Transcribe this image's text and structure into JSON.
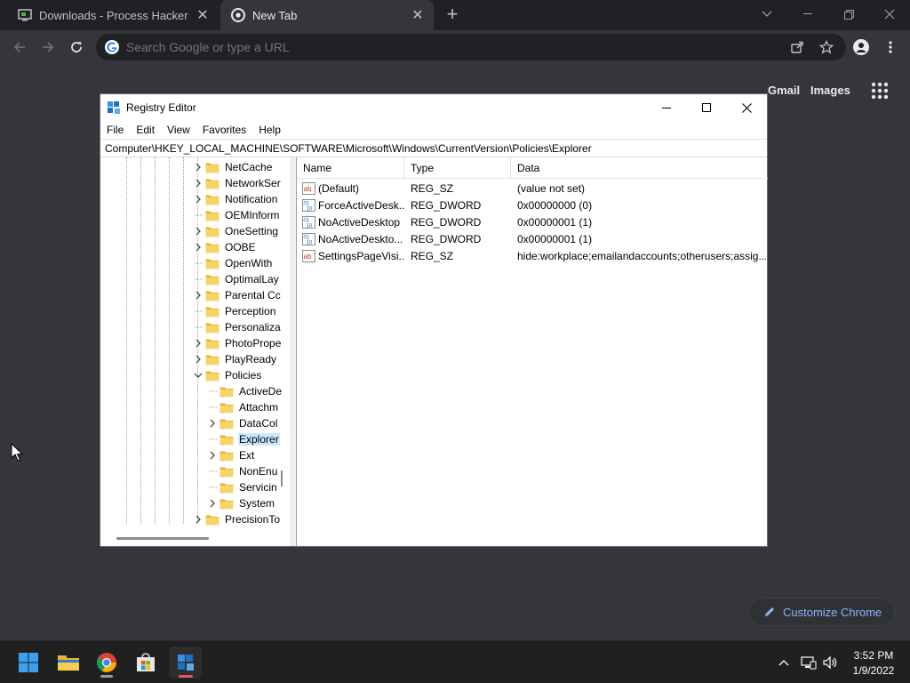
{
  "browser": {
    "tabs": [
      {
        "title": "Downloads - Process Hacker",
        "active": false
      },
      {
        "title": "New Tab",
        "active": true
      }
    ],
    "omnibox_placeholder": "Search Google or type a URL",
    "ntp": {
      "gmail": "Gmail",
      "images": "Images",
      "customize_label": "Customize Chrome"
    }
  },
  "regedit": {
    "title": "Registry Editor",
    "menu": [
      "File",
      "Edit",
      "View",
      "Favorites",
      "Help"
    ],
    "address": "Computer\\HKEY_LOCAL_MACHINE\\SOFTWARE\\Microsoft\\Windows\\CurrentVersion\\Policies\\Explorer",
    "tree": [
      {
        "label": "NetCache",
        "expander": true,
        "level": 0
      },
      {
        "label": "NetworkSer",
        "expander": true,
        "level": 0
      },
      {
        "label": "Notification",
        "expander": true,
        "level": 0
      },
      {
        "label": "OEMInform",
        "expander": false,
        "level": 0
      },
      {
        "label": "OneSetting",
        "expander": true,
        "level": 0
      },
      {
        "label": "OOBE",
        "expander": true,
        "level": 0
      },
      {
        "label": "OpenWith",
        "expander": false,
        "level": 0
      },
      {
        "label": "OptimalLay",
        "expander": false,
        "level": 0
      },
      {
        "label": "Parental Cc",
        "expander": true,
        "level": 0
      },
      {
        "label": "Perception",
        "expander": false,
        "level": 0
      },
      {
        "label": "Personaliza",
        "expander": false,
        "level": 0
      },
      {
        "label": "PhotoPrope",
        "expander": true,
        "level": 0
      },
      {
        "label": "PlayReady",
        "expander": true,
        "level": 0
      },
      {
        "label": "Policies",
        "expander": "open",
        "level": 0
      },
      {
        "label": "ActiveDe",
        "expander": false,
        "level": 1
      },
      {
        "label": "Attachm",
        "expander": false,
        "level": 1
      },
      {
        "label": "DataCol",
        "expander": true,
        "level": 1
      },
      {
        "label": "Explorer",
        "expander": false,
        "level": 1,
        "selected": true
      },
      {
        "label": "Ext",
        "expander": true,
        "level": 1
      },
      {
        "label": "NonEnu",
        "expander": false,
        "level": 1
      },
      {
        "label": "Servicin",
        "expander": false,
        "level": 1
      },
      {
        "label": "System",
        "expander": true,
        "level": 1
      },
      {
        "label": "PrecisionTo",
        "expander": true,
        "level": 0
      }
    ],
    "columns": {
      "name": "Name",
      "type": "Type",
      "data": "Data"
    },
    "values": [
      {
        "name": "(Default)",
        "type": "REG_SZ",
        "data": "(value not set)",
        "icon": "string-value-icon"
      },
      {
        "name": "ForceActiveDesk...",
        "type": "REG_DWORD",
        "data": "0x00000000 (0)",
        "icon": "binary-value-icon"
      },
      {
        "name": "NoActiveDesktop",
        "type": "REG_DWORD",
        "data": "0x00000001 (1)",
        "icon": "binary-value-icon"
      },
      {
        "name": "NoActiveDeskto...",
        "type": "REG_DWORD",
        "data": "0x00000001 (1)",
        "icon": "binary-value-icon"
      },
      {
        "name": "SettingsPageVisi...",
        "type": "REG_SZ",
        "data": "hide:workplace;emailandaccounts;otherusers;assig...",
        "icon": "string-value-icon"
      }
    ]
  },
  "taskbar": {
    "time": "3:52 PM",
    "date": "1/9/2022"
  },
  "colors": {
    "chrome_frame": "#202124",
    "chrome_tab": "#35363a",
    "accent_blue": "#8ab4f8",
    "selection": "#cce8ff",
    "taskbar": "#202020"
  }
}
